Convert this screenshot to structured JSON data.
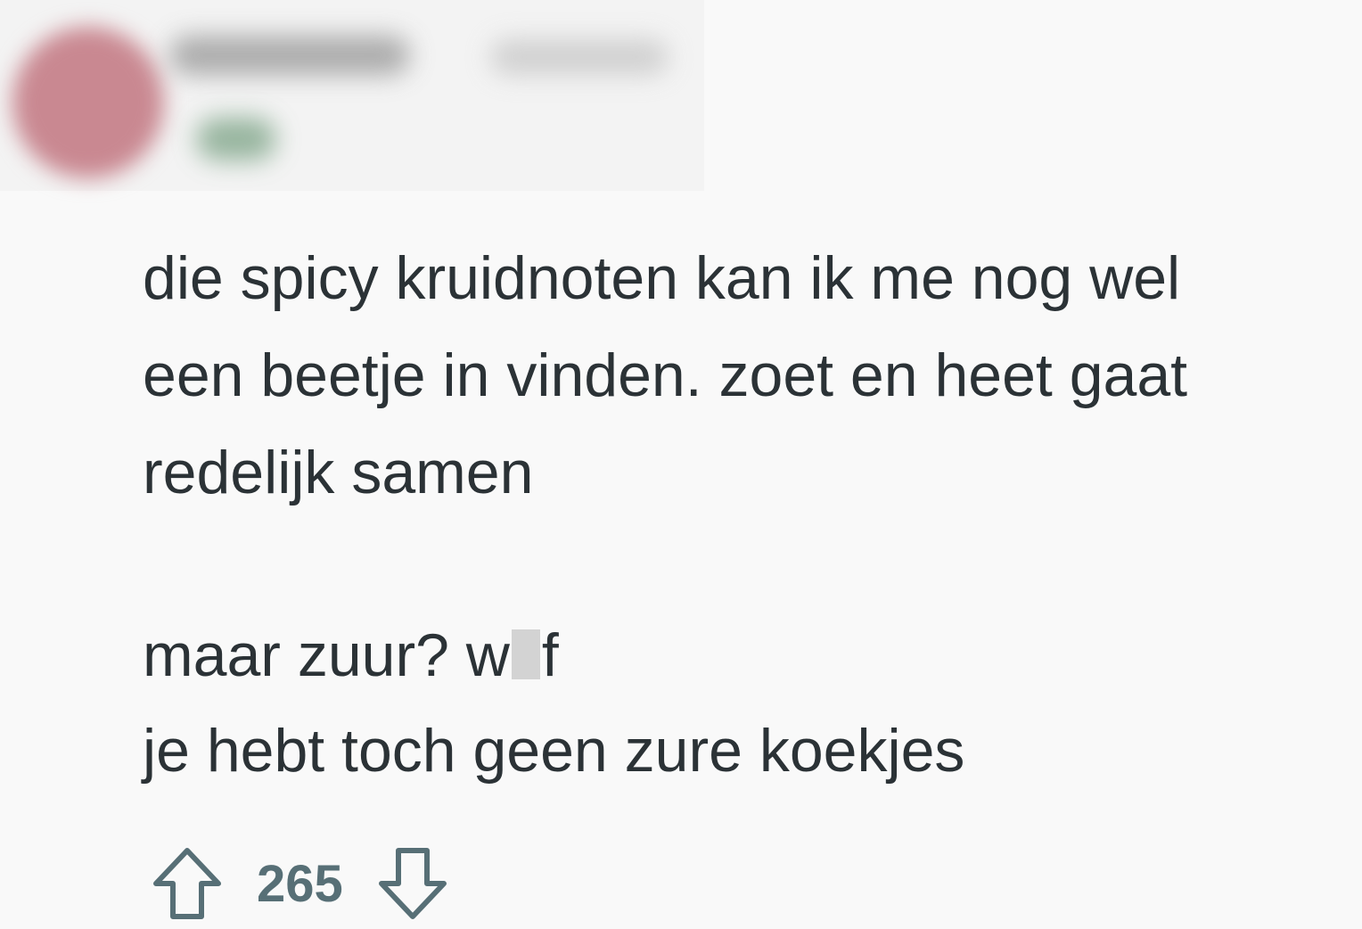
{
  "comment": {
    "lines": [
      "die spicy kruidnoten kan ik me nog wel",
      "een beetje in vinden. zoet en heet gaat",
      "redelijk samen"
    ],
    "line4_before": "maar zuur? w",
    "line4_after": "f",
    "line5": "je hebt toch geen zure koekjes"
  },
  "actions": {
    "vote_count": "265"
  },
  "icons": {
    "upvote": "arrow-up-icon",
    "downvote": "arrow-down-icon"
  },
  "colors": {
    "background": "#f9f9f9",
    "text": "#2b3236",
    "vote_count": "#576f76"
  }
}
